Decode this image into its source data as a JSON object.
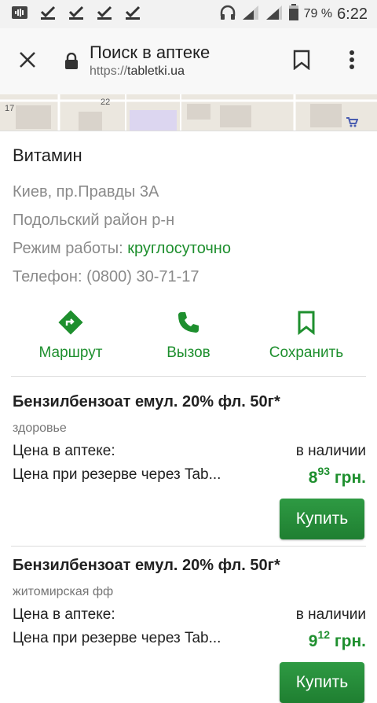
{
  "status_bar": {
    "battery_percent": "79 %",
    "time": "6:22"
  },
  "toolbar": {
    "title": "Поиск в аптеке",
    "url_scheme": "https://",
    "url_domain": "tabletki.ua"
  },
  "map": {
    "labels": [
      "17",
      "22"
    ]
  },
  "pharmacy": {
    "name": "Витамин",
    "address": "Киев, пр.Правды 3А",
    "district": "Подольский район р-н",
    "hours_label": "Режим работы: ",
    "hours_value": "круглосуточно",
    "phone": "Телефон: (0800) 30-71-17"
  },
  "actions": {
    "route": "Маршрут",
    "call": "Вызов",
    "save": "Сохранить"
  },
  "colors": {
    "accent": "#1e8f2e",
    "button": "#2e9a43"
  },
  "products": [
    {
      "title": "Бензилбензоат емул. 20% фл. 50г*",
      "maker": "здоровье",
      "price_label": "Цена в аптеке:",
      "availability": "в наличии",
      "reserve_label": "Цена при резерве через Tab...",
      "price_main": "8",
      "price_fraction": "93",
      "currency": " грн.",
      "buy_label": "Купить"
    },
    {
      "title": "Бензилбензоат емул. 20% фл. 50г*",
      "maker": "житомирская фф",
      "price_label": "Цена в аптеке:",
      "availability": "в наличии",
      "reserve_label": "Цена при резерве через Tab...",
      "price_main": "9",
      "price_fraction": "12",
      "currency": " грн.",
      "buy_label": "Купить"
    }
  ]
}
